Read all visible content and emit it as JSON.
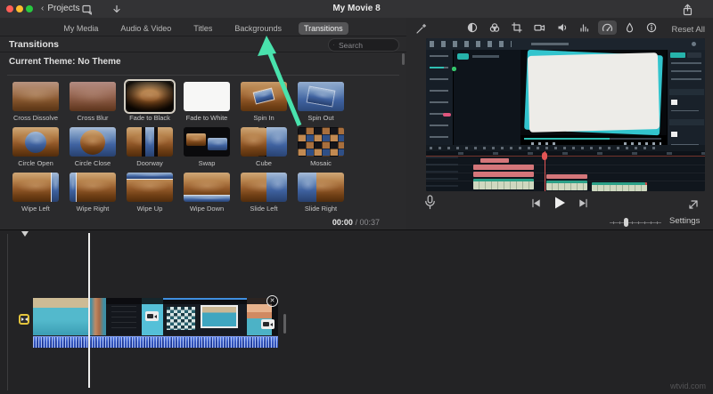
{
  "titlebar": {
    "back_label": "Projects",
    "title": "My Movie 8"
  },
  "tabs": {
    "items": [
      "My Media",
      "Audio & Video",
      "Titles",
      "Backgrounds",
      "Transitions"
    ],
    "selected": "Transitions"
  },
  "browser": {
    "panel_title": "Transitions",
    "search_placeholder": "Search",
    "theme_label": "Current Theme: No Theme",
    "time_current": "00:00",
    "time_separator": " / ",
    "time_total": "00:37",
    "transitions": [
      {
        "name": "Cross Dissolve",
        "visual": "cross-dissolve",
        "selected": false
      },
      {
        "name": "Cross Blur",
        "visual": "cross-blur",
        "selected": false
      },
      {
        "name": "Fade to Black",
        "visual": "fade-black",
        "selected": true
      },
      {
        "name": "Fade to White",
        "visual": "fade-white",
        "selected": false
      },
      {
        "name": "Spin In",
        "visual": "spin-in",
        "selected": false
      },
      {
        "name": "Spin Out",
        "visual": "spin-out",
        "selected": false
      },
      {
        "name": "Circle Open",
        "visual": "circle-open",
        "selected": false
      },
      {
        "name": "Circle Close",
        "visual": "circle-close",
        "selected": false
      },
      {
        "name": "Doorway",
        "visual": "doorway",
        "selected": false
      },
      {
        "name": "Swap",
        "visual": "swap",
        "selected": false
      },
      {
        "name": "Cube",
        "visual": "cube",
        "selected": false
      },
      {
        "name": "Mosaic",
        "visual": "mosaic",
        "selected": false
      },
      {
        "name": "Wipe Left",
        "visual": "wipe-left",
        "selected": false
      },
      {
        "name": "Wipe Right",
        "visual": "wipe-right",
        "selected": false
      },
      {
        "name": "Wipe Up",
        "visual": "wipe-up",
        "selected": false
      },
      {
        "name": "Wipe Down",
        "visual": "wipe-down",
        "selected": false
      },
      {
        "name": "Slide Left",
        "visual": "slide-left",
        "selected": false
      },
      {
        "name": "Slide Right",
        "visual": "slide-right",
        "selected": false
      }
    ]
  },
  "viewer": {
    "reset_all_label": "Reset All",
    "toolbar_icons": [
      "enhance-wand",
      "color-balance",
      "color-correction",
      "crop",
      "stabilization",
      "volume",
      "noise-equalizer",
      "speed",
      "filters",
      "info"
    ],
    "selected_tool": "speed"
  },
  "timeline_bar": {
    "settings_label": "Settings"
  },
  "annotation": {
    "arrow_color": "#49e2ad",
    "arrow_points_to": "Transitions tab"
  },
  "watermark": "wtvid.com"
}
